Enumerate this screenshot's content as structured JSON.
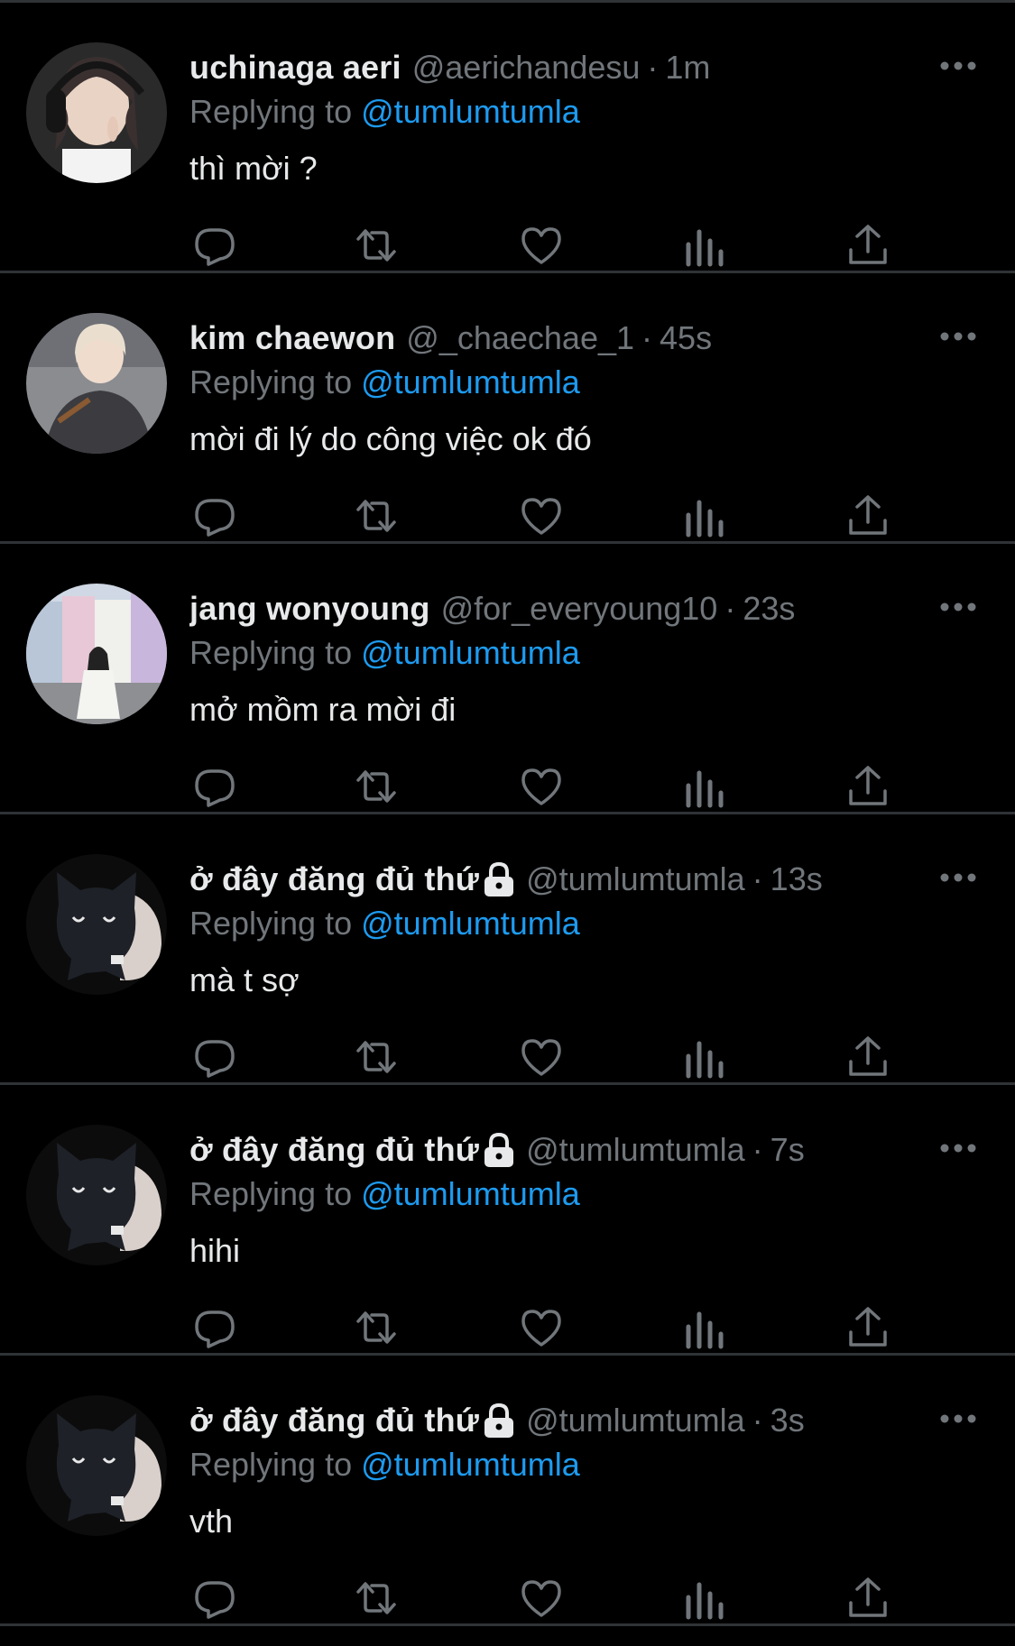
{
  "colors": {
    "background": "#000000",
    "text": "#e7e9ea",
    "secondary": "#71767b",
    "accent": "#1d9bf0",
    "divider": "#2f3336"
  },
  "replying_label": "Replying to",
  "tweets": [
    {
      "display_name": "uchinaga aeri",
      "handle": "@aerichandesu",
      "separator": "·",
      "time": "1m",
      "reply_to": "@tumlumtumla",
      "text": "thì mời ?",
      "protected": false,
      "avatar_icon": "profile-photo"
    },
    {
      "display_name": "kim chaewon",
      "handle": "@_chaechae_1",
      "separator": "·",
      "time": "45s",
      "reply_to": "@tumlumtumla",
      "text": "mời đi lý do công việc ok đó",
      "protected": false,
      "avatar_icon": "profile-photo"
    },
    {
      "display_name": "jang wonyoung",
      "handle": "@for_everyoung10",
      "separator": "·",
      "time": "23s",
      "reply_to": "@tumlumtumla",
      "text": "mở mồm ra mời đi",
      "protected": false,
      "avatar_icon": "profile-photo"
    },
    {
      "display_name": "ở đây đăng đủ thứ",
      "handle": "@tumlumtumla",
      "separator": "·",
      "time": "13s",
      "reply_to": "@tumlumtumla",
      "text": "mà t sợ",
      "protected": true,
      "avatar_icon": "black-cat-plush-photo"
    },
    {
      "display_name": "ở đây đăng đủ thứ",
      "handle": "@tumlumtumla",
      "separator": "·",
      "time": "7s",
      "reply_to": "@tumlumtumla",
      "text": "hihi",
      "protected": true,
      "avatar_icon": "black-cat-plush-photo"
    },
    {
      "display_name": "ở đây đăng đủ thứ",
      "handle": "@tumlumtumla",
      "separator": "·",
      "time": "3s",
      "reply_to": "@tumlumtumla",
      "text": "vth",
      "protected": true,
      "avatar_icon": "black-cat-plush-photo"
    }
  ],
  "action_icons": [
    "reply-icon",
    "retweet-icon",
    "like-icon",
    "views-icon",
    "share-icon"
  ]
}
